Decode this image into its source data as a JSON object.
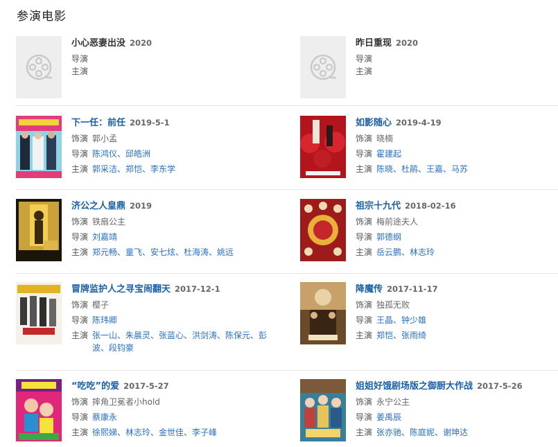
{
  "section_title": "参演电影",
  "labels": {
    "role": "饰演",
    "director": "导演",
    "cast": "主演"
  },
  "colors": {
    "link": "#2a6fc1",
    "title_link": "#1a5fa8",
    "placeholder_bg": "#eeeeee"
  },
  "movies": [
    {
      "title": "小心恶妻出没",
      "year": "2020",
      "has_poster": false,
      "role": "",
      "director": "",
      "cast": ""
    },
    {
      "title": "昨日重现",
      "year": "2020",
      "has_poster": false,
      "role": "",
      "director": "",
      "cast": ""
    },
    {
      "title": "下一任：前任",
      "year": "2019-5-1",
      "has_poster": true,
      "role": "郭小孟",
      "director": "陈鸿仪、邱皓洲",
      "cast": "郭采洁、郑恺、李东学"
    },
    {
      "title": "如影随心",
      "year": "2019-4-19",
      "has_poster": true,
      "role": "晓楠",
      "director": "霍建起",
      "cast": "陈晓、杜鹃、王嘉、马苏"
    },
    {
      "title": "济公之人皇鼎",
      "year": "2019",
      "has_poster": true,
      "role": "铁扇公主",
      "director": "刘嘉靖",
      "cast": "郑元畅、童飞、安七炫、杜海涛、姚远"
    },
    {
      "title": "祖宗十九代",
      "year": "2018-02-16",
      "has_poster": true,
      "role": "梅前途夫人",
      "director": "郭德纲",
      "cast": "岳云鹏、林志玲"
    },
    {
      "title": "冒牌监护人之寻宝闹翻天",
      "year": "2017-12-1",
      "has_poster": true,
      "role": "樱子",
      "director": "陈玮卿",
      "cast": "张一山、朱晨灵、张蓝心、洪剑涛、陈保元、彭波、段钧豪"
    },
    {
      "title": "降魔传",
      "year": "2017-11-17",
      "has_poster": true,
      "role": "独孤无败",
      "director": "王晶、钟少雄",
      "cast": "郑恺、张雨绮"
    },
    {
      "title": "“吃吃”的爱",
      "year": "2017-5-27",
      "has_poster": true,
      "role": "摔角卫冕者小hold",
      "director": "蔡康永",
      "cast": "徐熙娣、林志玲、金世佳、李子峰"
    },
    {
      "title": "姐姐好饿剧场版之御厨大作战",
      "year": "2017-5-26",
      "has_poster": true,
      "role": "永宁公主",
      "director": "姜禹辰",
      "cast": "张亦驰、陈庭妮、谢坤达"
    }
  ]
}
